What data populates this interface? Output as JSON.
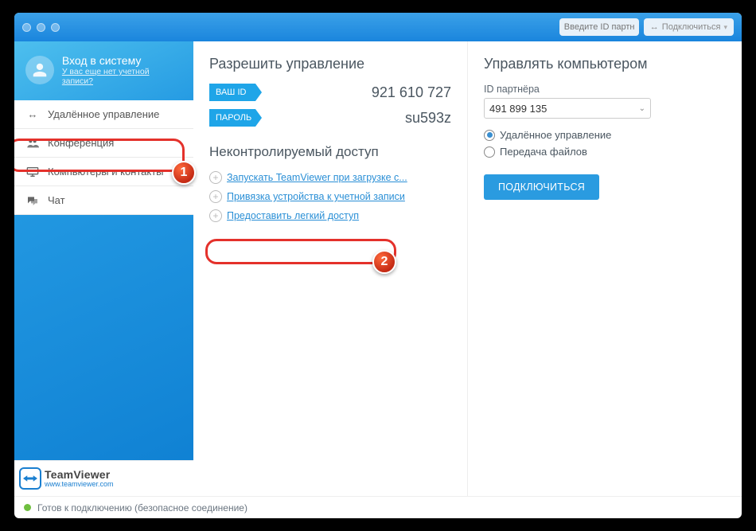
{
  "titlebar": {
    "partner_id_placeholder": "Введите ID партн",
    "connect_label": "Подключиться"
  },
  "sidebar": {
    "login_title": "Вход в систему",
    "login_sub": "У вас еще нет учетной записи?",
    "items": [
      {
        "label": "Удалённое управление"
      },
      {
        "label": "Конференция"
      },
      {
        "label": "Компьютеры и контакты"
      },
      {
        "label": "Чат"
      }
    ],
    "brand": "TeamViewer",
    "brand_url": "www.teamviewer.com"
  },
  "allow": {
    "heading": "Разрешить управление",
    "id_label": "ВАШ ID",
    "id_value": "921 610 727",
    "pw_label": "ПАРОЛЬ",
    "pw_value": "su593z",
    "unattended_heading": "Неконтролируемый доступ",
    "links": [
      "Запускать TeamViewer при загрузке с...",
      "Привязка устройства к учетной записи",
      "Предоставить легкий доступ"
    ]
  },
  "control": {
    "heading": "Управлять компьютером",
    "partner_label": "ID партнёра",
    "partner_value": "491 899 135",
    "radio_remote": "Удалённое управление",
    "radio_files": "Передача файлов",
    "connect_btn": "ПОДКЛЮЧИТЬСЯ"
  },
  "status": "Готов к подключению (безопасное соединение)",
  "badges": {
    "one": "1",
    "two": "2"
  }
}
